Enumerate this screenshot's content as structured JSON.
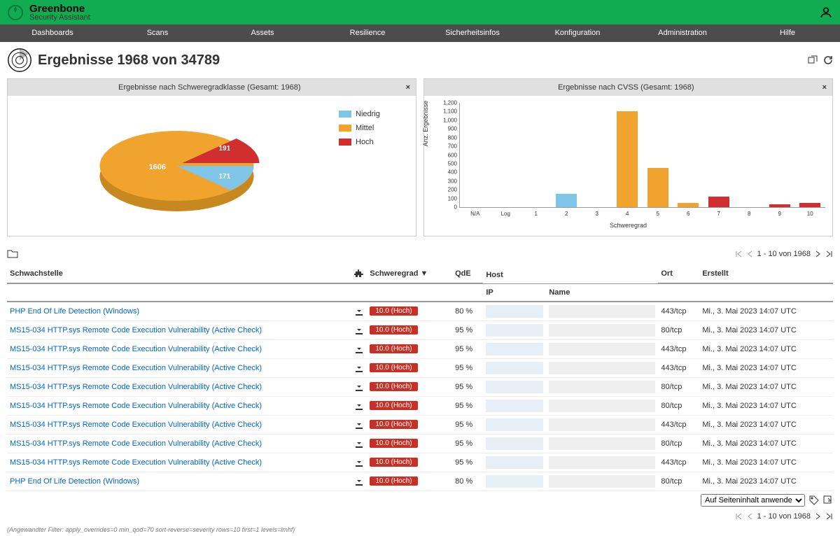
{
  "app": {
    "name": "Greenbone",
    "subtitle": "Security Assistant"
  },
  "nav": [
    "Dashboards",
    "Scans",
    "Assets",
    "Resilience",
    "Sicherheitsinfos",
    "Konfiguration",
    "Administration",
    "Hilfe"
  ],
  "page_title": "Ergebnisse 1968 von 34789",
  "chart1": {
    "title": "Ergebnisse nach Schweregradklasse (Gesamt: 1968)",
    "legend": [
      {
        "label": "Niedrig",
        "color": "#7fc5e8"
      },
      {
        "label": "Mittel",
        "color": "#f0a42e"
      },
      {
        "label": "Hoch",
        "color": "#d12f2f"
      }
    ],
    "slices": {
      "mittel": "1606",
      "hoch": "191",
      "niedrig": "171"
    }
  },
  "chart2": {
    "title": "Ergebnisse nach CVSS (Gesamt: 1968)",
    "ylabel": "Anz. Ergebnisse",
    "xlabel": "Schweregrad"
  },
  "chart_data": [
    {
      "type": "pie",
      "title": "Ergebnisse nach Schweregradklasse (Gesamt: 1968)",
      "series": [
        {
          "name": "Mittel",
          "value": 1606,
          "color": "#f0a42e"
        },
        {
          "name": "Hoch",
          "value": 191,
          "color": "#d12f2f"
        },
        {
          "name": "Niedrig",
          "value": 171,
          "color": "#7fc5e8"
        }
      ]
    },
    {
      "type": "bar",
      "title": "Ergebnisse nach CVSS (Gesamt: 1968)",
      "xlabel": "Schweregrad",
      "ylabel": "Anz. Ergebnisse",
      "ylim": [
        0,
        1200
      ],
      "yticks": [
        0,
        100,
        200,
        300,
        400,
        500,
        600,
        700,
        800,
        900,
        1000,
        1100,
        1200
      ],
      "categories": [
        "N/A",
        "Log",
        "1",
        "2",
        "3",
        "4",
        "5",
        "6",
        "7",
        "8",
        "9",
        "10"
      ],
      "values": [
        0,
        0,
        0,
        150,
        0,
        1100,
        450,
        50,
        120,
        0,
        30,
        50
      ],
      "colors": [
        "#7fc5e8",
        "#7fc5e8",
        "#7fc5e8",
        "#7fc5e8",
        "#f0a42e",
        "#f0a42e",
        "#f0a42e",
        "#f0a42e",
        "#d12f2f",
        "#d12f2f",
        "#d12f2f",
        "#d12f2f"
      ]
    }
  ],
  "pager_text": "1 - 10 von 1968",
  "columns": {
    "vuln": "Schwachstelle",
    "sev": "Schweregrad ▼",
    "qde": "QdE",
    "host": "Host",
    "ip": "IP",
    "name": "Name",
    "ort": "Ort",
    "erstellt": "Erstellt"
  },
  "rows": [
    {
      "vuln": "PHP End Of Life Detection (Windows)",
      "sev": "10.0 (Hoch)",
      "qde": "80 %",
      "ort": "443/tcp",
      "erstellt": "Mi., 3. Mai 2023 14:07 UTC"
    },
    {
      "vuln": "MS15-034 HTTP.sys Remote Code Execution Vulnerability (Active Check)",
      "sev": "10.0 (Hoch)",
      "qde": "95 %",
      "ort": "80/tcp",
      "erstellt": "Mi., 3. Mai 2023 14:07 UTC"
    },
    {
      "vuln": "MS15-034 HTTP.sys Remote Code Execution Vulnerability (Active Check)",
      "sev": "10.0 (Hoch)",
      "qde": "95 %",
      "ort": "443/tcp",
      "erstellt": "Mi., 3. Mai 2023 14:07 UTC"
    },
    {
      "vuln": "MS15-034 HTTP.sys Remote Code Execution Vulnerability (Active Check)",
      "sev": "10.0 (Hoch)",
      "qde": "95 %",
      "ort": "443/tcp",
      "erstellt": "Mi., 3. Mai 2023 14:07 UTC"
    },
    {
      "vuln": "MS15-034 HTTP.sys Remote Code Execution Vulnerability (Active Check)",
      "sev": "10.0 (Hoch)",
      "qde": "95 %",
      "ort": "80/tcp",
      "erstellt": "Mi., 3. Mai 2023 14:07 UTC"
    },
    {
      "vuln": "MS15-034 HTTP.sys Remote Code Execution Vulnerability (Active Check)",
      "sev": "10.0 (Hoch)",
      "qde": "95 %",
      "ort": "80/tcp",
      "erstellt": "Mi., 3. Mai 2023 14:07 UTC"
    },
    {
      "vuln": "MS15-034 HTTP.sys Remote Code Execution Vulnerability (Active Check)",
      "sev": "10.0 (Hoch)",
      "qde": "95 %",
      "ort": "443/tcp",
      "erstellt": "Mi., 3. Mai 2023 14:07 UTC"
    },
    {
      "vuln": "MS15-034 HTTP.sys Remote Code Execution Vulnerability (Active Check)",
      "sev": "10.0 (Hoch)",
      "qde": "95 %",
      "ort": "80/tcp",
      "erstellt": "Mi., 3. Mai 2023 14:07 UTC"
    },
    {
      "vuln": "MS15-034 HTTP.sys Remote Code Execution Vulnerability (Active Check)",
      "sev": "10.0 (Hoch)",
      "qde": "95 %",
      "ort": "443/tcp",
      "erstellt": "Mi., 3. Mai 2023 14:07 UTC"
    },
    {
      "vuln": "PHP End Of Life Detection (Windows)",
      "sev": "10.0 (Hoch)",
      "qde": "80 %",
      "ort": "80/tcp",
      "erstellt": "Mi., 3. Mai 2023 14:07 UTC"
    }
  ],
  "filter_select": "Auf Seiteninhalt anwende",
  "footer_filter": "(Angewandter Filter: apply_overrides=0 min_qod=70 sort-reverse=severity rows=10 first=1 levels=lmhf)"
}
